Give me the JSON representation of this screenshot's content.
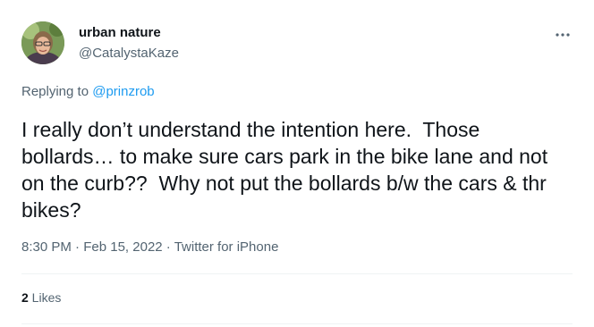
{
  "author": {
    "name": "urban nature",
    "handle": "@CatalystaKaze"
  },
  "reply": {
    "prefix": "Replying to ",
    "mention": "@prinzrob"
  },
  "tweet": {
    "text": "I really don’t understand the intention here.  Those bollards… to make sure cars park in the bike lane and not on the curb??  Why not put the bollards b/w the cars & thr bikes?"
  },
  "meta": {
    "time": "8:30 PM",
    "sep1": " · ",
    "date": "Feb 15, 2022",
    "sep2": " · ",
    "source": "Twitter for iPhone"
  },
  "stats": {
    "likes_count": "2",
    "likes_label": " Likes"
  },
  "icons": {
    "more": "more-horizontal-icon"
  },
  "colors": {
    "text_primary": "#0f1419",
    "text_secondary": "#536471",
    "accent": "#1d9bf0",
    "divider": "#eff3f4"
  }
}
